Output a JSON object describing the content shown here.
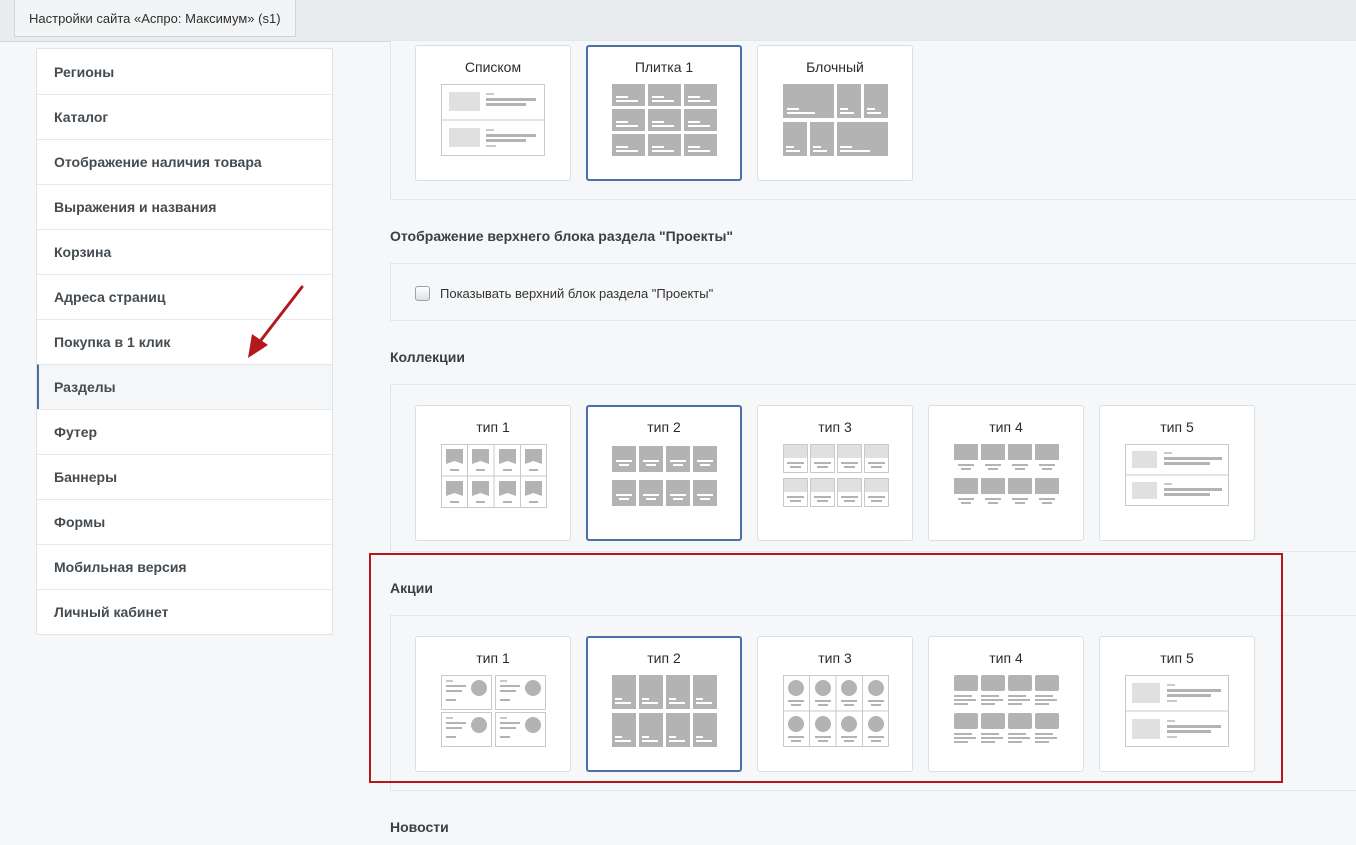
{
  "window": {
    "tab_title": "Настройки сайта «Аспро: Максимум» (s1)"
  },
  "sidebar": {
    "active_index": 7,
    "items": [
      {
        "label": "Регионы"
      },
      {
        "label": "Каталог"
      },
      {
        "label": "Отображение наличия товара"
      },
      {
        "label": "Выражения и названия"
      },
      {
        "label": "Корзина"
      },
      {
        "label": "Адреса страниц"
      },
      {
        "label": "Покупка в 1 клик"
      },
      {
        "label": "Разделы"
      },
      {
        "label": "Футер"
      },
      {
        "label": "Баннеры"
      },
      {
        "label": "Формы"
      },
      {
        "label": "Мобильная версия"
      },
      {
        "label": "Личный кабинет"
      }
    ]
  },
  "sections": {
    "view_type": {
      "options": [
        {
          "label": "Списком",
          "selected": false
        },
        {
          "label": "Плитка 1",
          "selected": true
        },
        {
          "label": "Блочный",
          "selected": false
        }
      ]
    },
    "projects_top_block": {
      "title": "Отображение верхнего блока раздела \"Проекты\"",
      "checkbox_label": "Показывать верхний блок раздела \"Проекты\"",
      "checked": false
    },
    "collections": {
      "title": "Коллекции",
      "options": [
        {
          "label": "тип 1",
          "selected": false
        },
        {
          "label": "тип 2",
          "selected": true
        },
        {
          "label": "тип 3",
          "selected": false
        },
        {
          "label": "тип 4",
          "selected": false
        },
        {
          "label": "тип 5",
          "selected": false
        }
      ]
    },
    "promotions": {
      "title": "Акции",
      "options": [
        {
          "label": "тип 1",
          "selected": false
        },
        {
          "label": "тип 2",
          "selected": true
        },
        {
          "label": "тип 3",
          "selected": false
        },
        {
          "label": "тип 4",
          "selected": false
        },
        {
          "label": "тип 5",
          "selected": false
        }
      ]
    },
    "news": {
      "title": "Новости"
    }
  },
  "colors": {
    "selected_border": "#4a6fa5",
    "annotation_red": "#b3191c",
    "placeholder_gray": "#b8b8b8"
  }
}
